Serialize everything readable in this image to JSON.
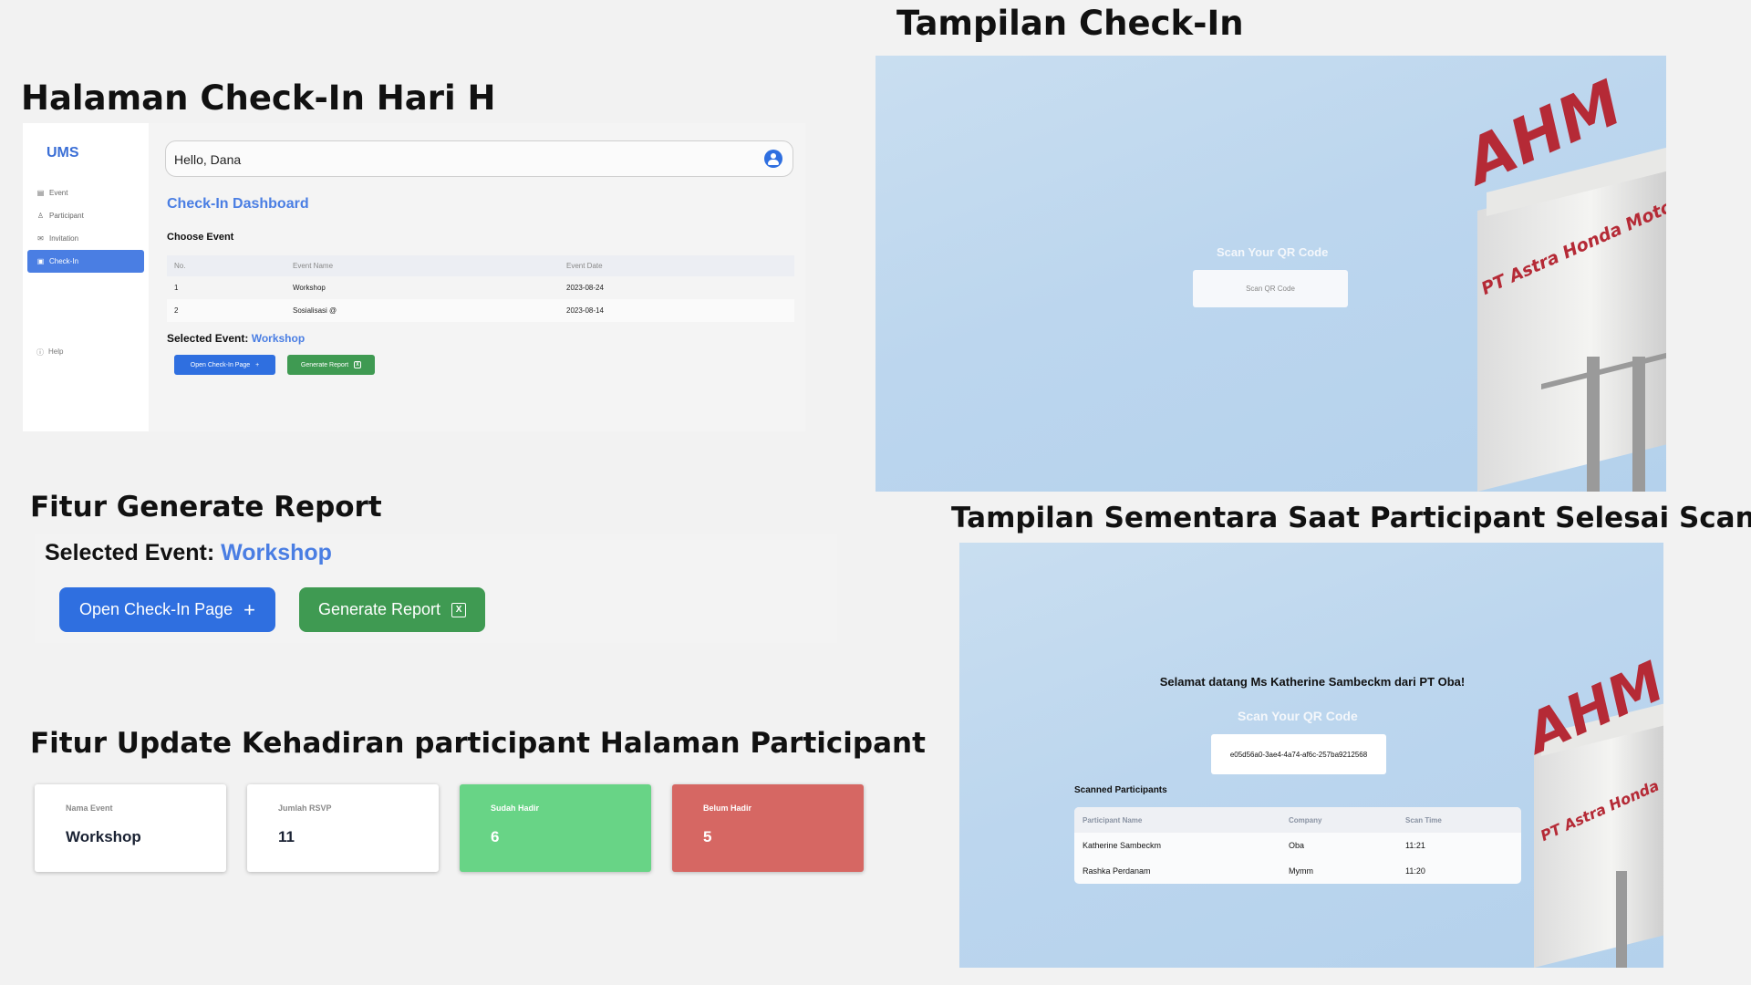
{
  "headings": {
    "checkin_page": "Halaman Check-In Hari H",
    "checkin_display": "Tampilan Check-In",
    "generate_report": "Fitur Generate Report",
    "temp_display": "Tampilan Sementara Saat Participant Selesai Scan QR",
    "update_attendance": "Fitur Update Kehadiran participant Halaman Participant"
  },
  "sidebar": {
    "logo": "UMS",
    "items": [
      {
        "label": "Event",
        "icon": "calendar-icon"
      },
      {
        "label": "Participant",
        "icon": "person-icon"
      },
      {
        "label": "Invitation",
        "icon": "mail-icon"
      },
      {
        "label": "Check-In",
        "icon": "calendar-check-icon",
        "active": true
      }
    ],
    "help": "Help"
  },
  "header": {
    "greeting": "Hello, Dana"
  },
  "dashboard": {
    "title": "Check-In Dashboard",
    "choose_event": "Choose Event",
    "columns": [
      "No.",
      "Event Name",
      "Event Date"
    ],
    "rows": [
      {
        "no": "1",
        "name": "Workshop",
        "date": "2023-08-24"
      },
      {
        "no": "2",
        "name": "Sosialisasi @",
        "date": "2023-08-14"
      }
    ],
    "selected_label": "Selected Event:",
    "selected_value": "Workshop",
    "open_button": "Open Check-In Page",
    "report_button": "Generate Report"
  },
  "report": {
    "selected_label": "Selected Event:",
    "selected_value": "Workshop",
    "open_button": "Open Check-In Page",
    "report_button": "Generate Report"
  },
  "stats": [
    {
      "label": "Nama Event",
      "value": "Workshop"
    },
    {
      "label": "Jumlah RSVP",
      "value": "11"
    },
    {
      "label": "Sudah Hadir",
      "value": "6"
    },
    {
      "label": "Belum Hadir",
      "value": "5"
    }
  ],
  "scan_screen": {
    "title": "Scan Your QR Code",
    "placeholder": "Scan QR Code",
    "logo": "AHM",
    "company": "PT Astra Honda Motor"
  },
  "scan_result": {
    "welcome": "Selamat datang Ms Katherine Sambeckm dari PT Oba!",
    "title": "Scan Your QR Code",
    "input_value": "e05d56a0-3ae4-4a74-af6c-257ba9212568",
    "scanned_title": "Scanned Participants",
    "columns": [
      "Participant Name",
      "Company",
      "Scan Time"
    ],
    "rows": [
      {
        "name": "Katherine Sambeckm",
        "company": "Oba",
        "time": "11:21"
      },
      {
        "name": "Rashka Perdanam",
        "company": "Mymm",
        "time": "11:20"
      }
    ],
    "logo": "AHM",
    "company": "PT Astra Honda"
  },
  "colors": {
    "accent": "#4a7ee3",
    "button_blue": "#2f6fe0",
    "button_green": "#3f9a52",
    "stat_green": "#68d486",
    "stat_red": "#d66763",
    "brand_red": "#b52a36"
  }
}
